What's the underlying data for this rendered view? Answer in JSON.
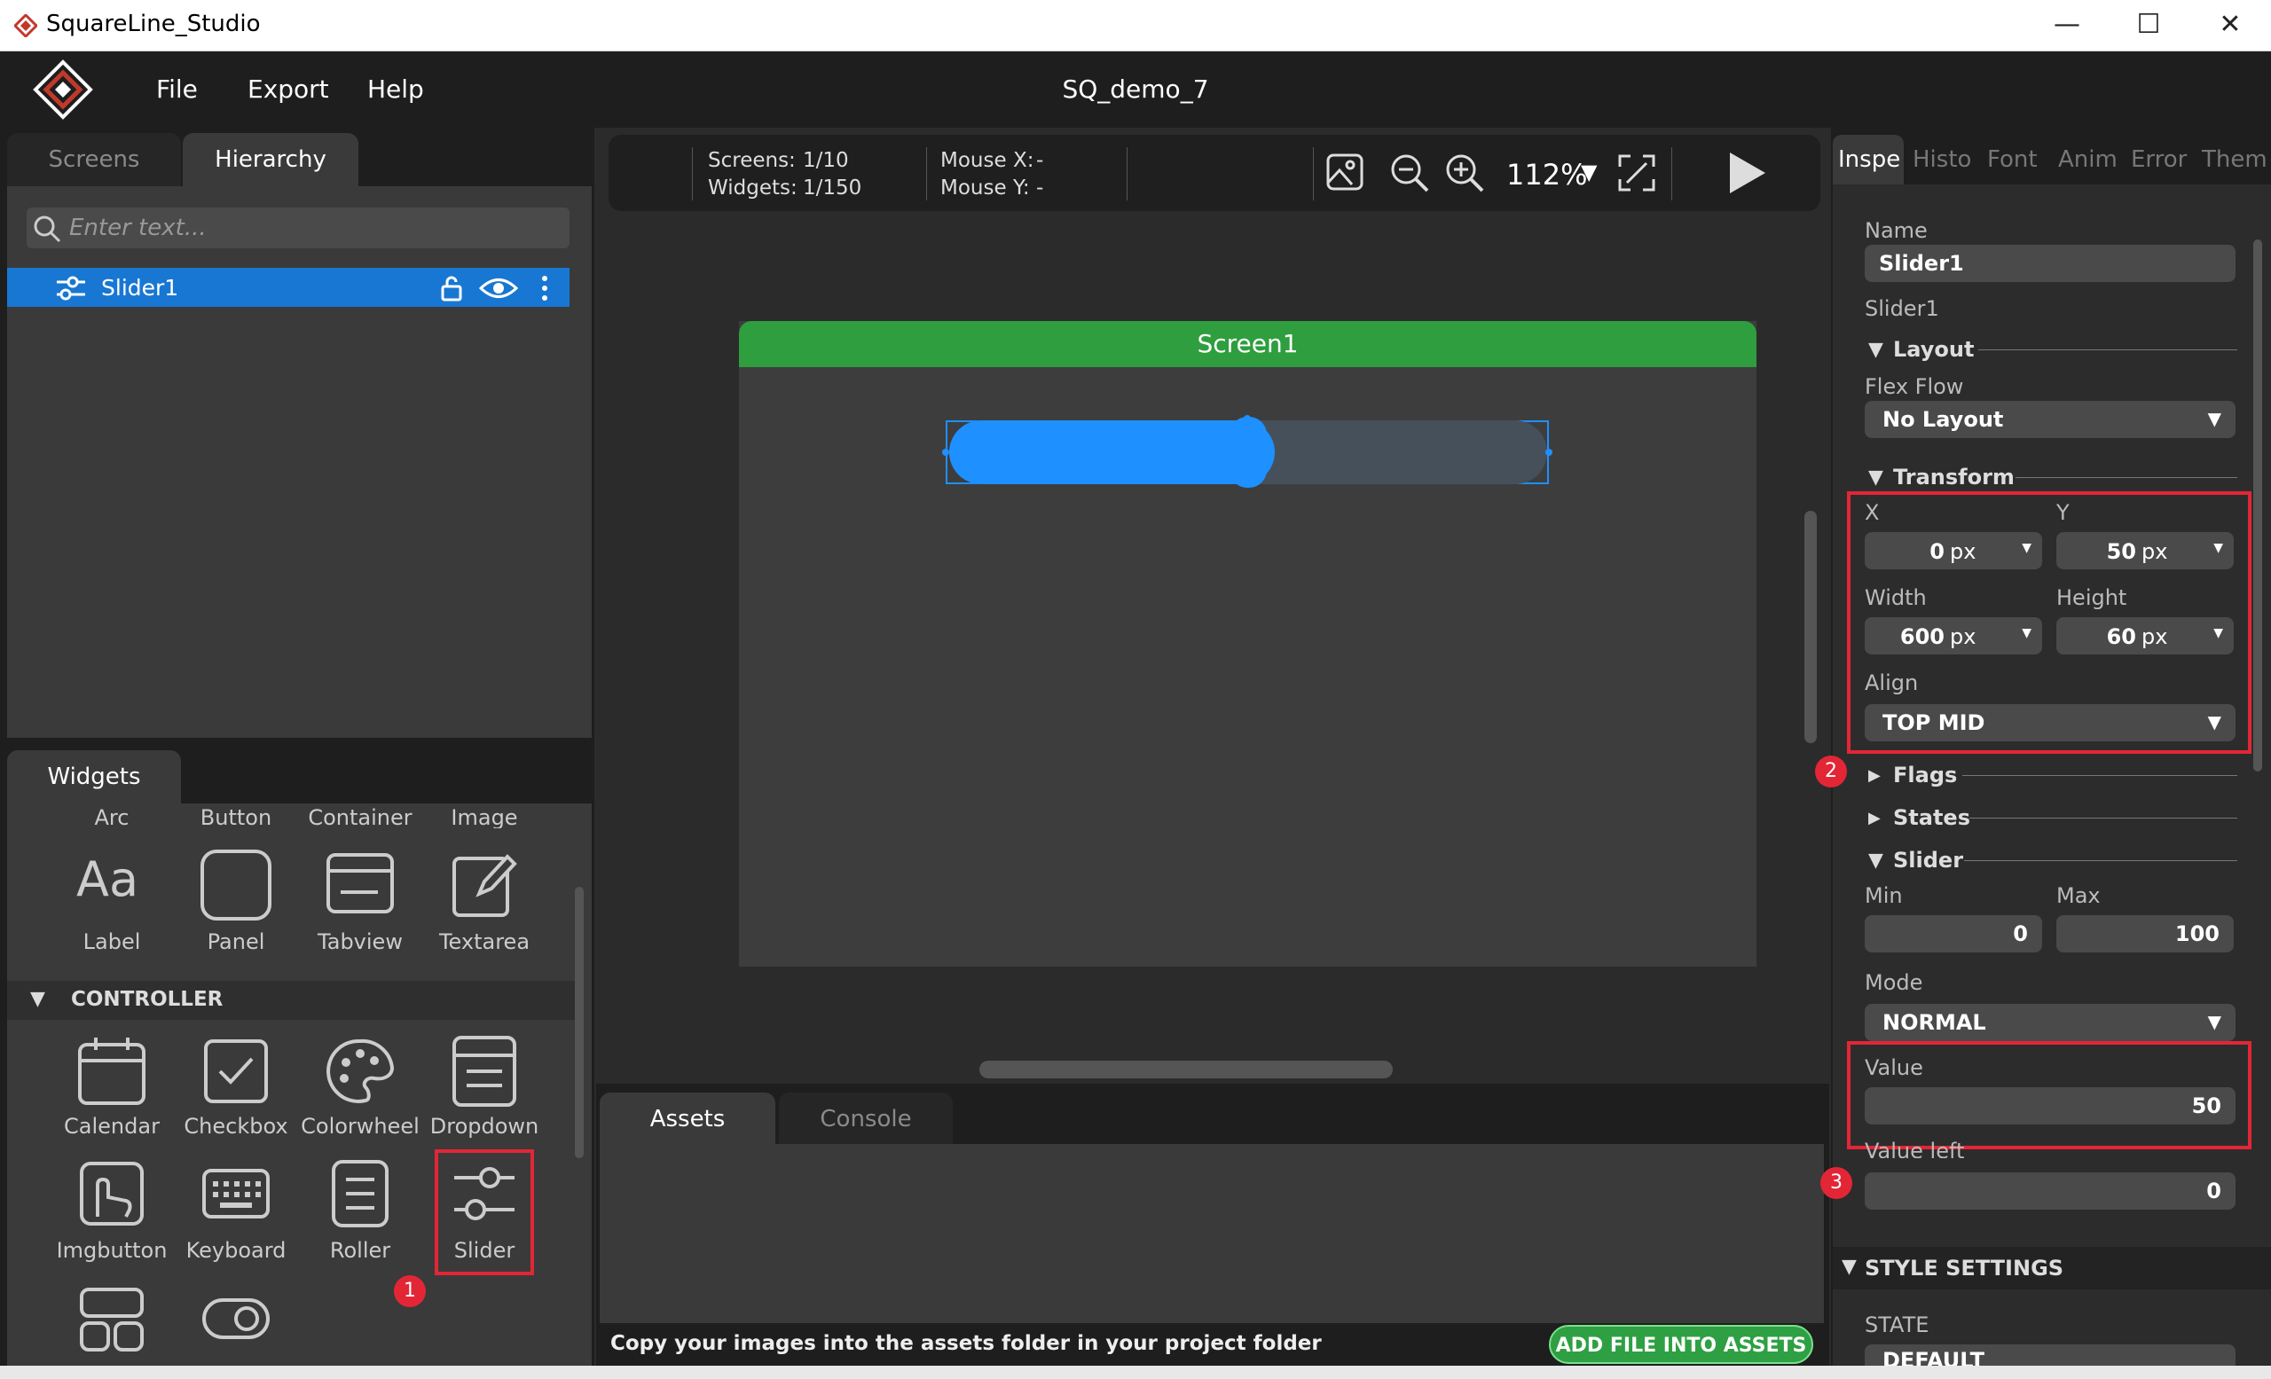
{
  "window": {
    "title": "SquareLine_Studio",
    "minimize": "—",
    "maximize": "☐",
    "close": "✕"
  },
  "menu": {
    "file": "File",
    "export": "Export",
    "help": "Help",
    "project": "SQ_demo_7"
  },
  "left": {
    "tabs": {
      "screens": "Screens",
      "hierarchy": "Hierarchy"
    },
    "search_placeholder": "Enter text...",
    "hierarchy_item": "Slider1",
    "widgets_tab": "Widgets",
    "widgets_top": [
      "Arc",
      "Button",
      "Container",
      "Image"
    ],
    "widgets_row1": [
      "Label",
      "Panel",
      "Tabview",
      "Textarea"
    ],
    "controller_section": "CONTROLLER",
    "widgets_row2": [
      "Calendar",
      "Checkbox",
      "Colorwheel",
      "Dropdown"
    ],
    "widgets_row3": [
      "Imgbutton",
      "Keyboard",
      "Roller",
      "Slider"
    ],
    "label_glyph": "Aa"
  },
  "toolbar": {
    "screens_label": "Screens:",
    "screens_value": "1/10",
    "widgets_label": "Widgets:",
    "widgets_value": "1/150",
    "mousex_label": "Mouse X:",
    "mousex_value": "-",
    "mousey_label": "Mouse Y:",
    "mousey_value": "-",
    "zoom": "112%"
  },
  "canvas": {
    "screen_name": "Screen1",
    "slider_value_fraction": 0.5
  },
  "bottom": {
    "tabs": {
      "assets": "Assets",
      "console": "Console"
    },
    "hint": "Copy your images into the assets folder in your project folder",
    "add_button": "ADD FILE INTO ASSETS"
  },
  "inspector": {
    "tabs": [
      "Inspe",
      "Histo",
      "Font",
      "Anim",
      "Error",
      "Them"
    ],
    "name_label": "Name",
    "name_value": "Slider1",
    "type_label": "Slider1",
    "layout_section": "Layout",
    "flexflow_label": "Flex Flow",
    "flexflow_value": "No Layout",
    "transform_section": "Transform",
    "x_label": "X",
    "x_value": "0",
    "x_unit": "px",
    "y_label": "Y",
    "y_value": "50",
    "y_unit": "px",
    "width_label": "Width",
    "width_value": "600",
    "width_unit": "px",
    "height_label": "Height",
    "height_value": "60",
    "height_unit": "px",
    "align_label": "Align",
    "align_value": "TOP MID",
    "flags_section": "Flags",
    "states_section": "States",
    "slider_section": "Slider",
    "min_label": "Min",
    "min_value": "0",
    "max_label": "Max",
    "max_value": "100",
    "mode_label": "Mode",
    "mode_value": "NORMAL",
    "value_label": "Value",
    "value_value": "50",
    "valueleft_label": "Value left",
    "valueleft_value": "0",
    "style_section": "STYLE SETTINGS",
    "state_label": "STATE",
    "state_value": "DEFAULT"
  },
  "badges": {
    "one": "1",
    "two": "2",
    "three": "3"
  },
  "colors": {
    "accent": "#1e90ff",
    "screen_header": "#2e9e3e",
    "highlight": "#e32636",
    "add_button": "#2ea043"
  }
}
